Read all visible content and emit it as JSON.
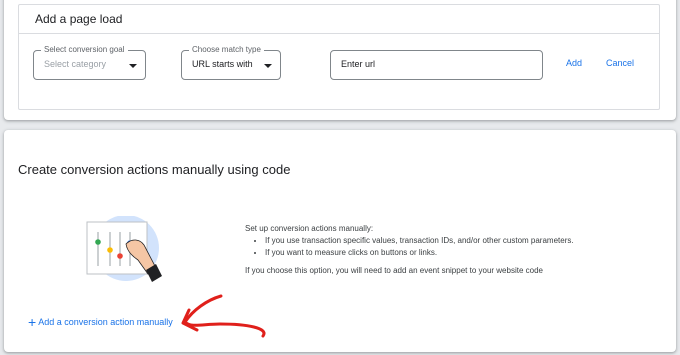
{
  "page_load": {
    "title": "Add a page load",
    "goal": {
      "legend": "Select conversion goal",
      "value": "Select category"
    },
    "match": {
      "legend": "Choose match type",
      "value": "URL starts with"
    },
    "url": {
      "value": "Enter url"
    },
    "add_label": "Add",
    "cancel_label": "Cancel"
  },
  "manual": {
    "title": "Create conversion actions manually using code",
    "intro": "Set up conversion actions manually:",
    "bullets": [
      "If you use transaction specific values, transaction IDs, and/or other custom parameters.",
      "If you want to measure clicks on buttons or links."
    ],
    "note": "If you choose this option, you will need to add an event snippet to your website code",
    "add_link": "Add a conversion action manually"
  },
  "colors": {
    "link": "#1a73e8",
    "annotation_arrow": "#e0201b"
  }
}
